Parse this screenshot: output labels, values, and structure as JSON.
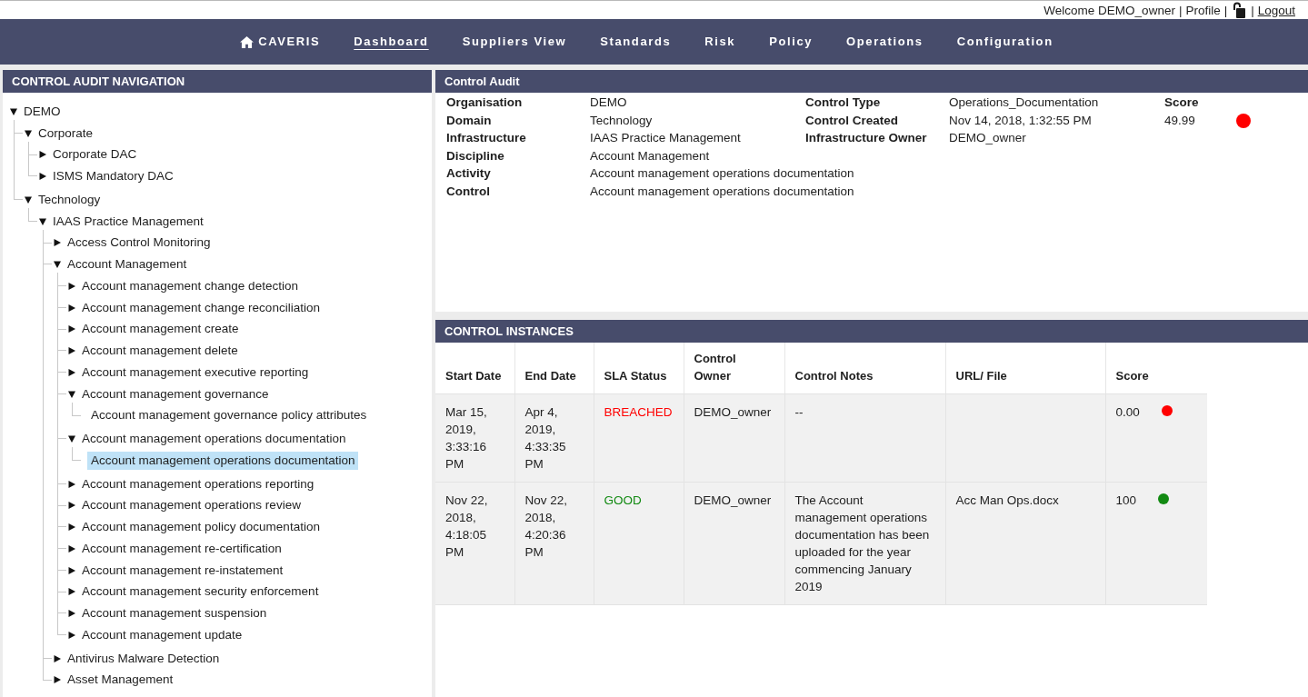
{
  "top_bar": {
    "items": [
      {
        "kind": "text",
        "text": "Welcome DEMO_owner"
      },
      {
        "kind": "separator",
        "text": "|"
      },
      {
        "kind": "link",
        "text": "Profile"
      },
      {
        "kind": "separator",
        "text": "|"
      },
      {
        "kind": "icon"
      },
      {
        "kind": "separator",
        "text": "|"
      },
      {
        "kind": "underlined_link",
        "text": "Logout"
      }
    ]
  },
  "navbar": {
    "brand": "CAVERIS",
    "items": [
      {
        "label": "Dashboard",
        "selected": true
      },
      {
        "label": "Suppliers View",
        "selected": false
      },
      {
        "label": "Standards",
        "selected": false
      },
      {
        "label": "Risk",
        "selected": false
      },
      {
        "label": "Policy",
        "selected": false
      },
      {
        "label": "Operations",
        "selected": false
      },
      {
        "label": "Configuration",
        "selected": false
      }
    ]
  },
  "navigation": {
    "title": "CONTROL AUDIT NAVIGATION",
    "tree": [
      {
        "label": "DEMO",
        "expanded": true,
        "selected": false,
        "children": [
          {
            "label": "Corporate",
            "expanded": true,
            "selected": false,
            "children": [
              {
                "label": "Corporate DAC",
                "expanded": false,
                "selected": false
              },
              {
                "label": "ISMS Mandatory DAC",
                "expanded": false,
                "selected": false
              }
            ]
          },
          {
            "label": "Technology",
            "expanded": true,
            "selected": false,
            "children": [
              {
                "label": "IAAS Practice Management",
                "expanded": true,
                "selected": false,
                "children": [
                  {
                    "label": "Access Control Monitoring",
                    "expanded": false,
                    "selected": false
                  },
                  {
                    "label": "Account Management",
                    "expanded": true,
                    "selected": false,
                    "children": [
                      {
                        "label": "Account management change detection",
                        "expanded": false,
                        "selected": false
                      },
                      {
                        "label": "Account management change reconciliation",
                        "expanded": false,
                        "selected": false
                      },
                      {
                        "label": "Account management create",
                        "expanded": false,
                        "selected": false
                      },
                      {
                        "label": "Account management delete",
                        "expanded": false,
                        "selected": false
                      },
                      {
                        "label": "Account management executive reporting",
                        "expanded": false,
                        "selected": false
                      },
                      {
                        "label": "Account management governance",
                        "expanded": true,
                        "selected": false,
                        "children": [
                          {
                            "label": "Account management governance policy attributes",
                            "selected": false
                          }
                        ]
                      },
                      {
                        "label": "Account management operations documentation",
                        "expanded": true,
                        "selected": false,
                        "children": [
                          {
                            "label": "Account management operations documentation",
                            "selected": true
                          }
                        ]
                      },
                      {
                        "label": "Account management operations reporting",
                        "expanded": false,
                        "selected": false
                      },
                      {
                        "label": "Account management operations review",
                        "expanded": false,
                        "selected": false
                      },
                      {
                        "label": "Account management policy documentation",
                        "expanded": false,
                        "selected": false
                      },
                      {
                        "label": "Account management re-certification",
                        "expanded": false,
                        "selected": false
                      },
                      {
                        "label": "Account management re-instatement",
                        "expanded": false,
                        "selected": false
                      },
                      {
                        "label": "Account management security enforcement",
                        "expanded": false,
                        "selected": false
                      },
                      {
                        "label": "Account management suspension",
                        "expanded": false,
                        "selected": false
                      },
                      {
                        "label": "Account management update",
                        "expanded": false,
                        "selected": false
                      }
                    ]
                  },
                  {
                    "label": "Antivirus Malware Detection",
                    "expanded": false,
                    "selected": false
                  },
                  {
                    "label": "Asset Management",
                    "expanded": false,
                    "selected": false
                  }
                ]
              }
            ]
          }
        ]
      }
    ]
  },
  "control_audit": {
    "title": "Control Audit",
    "fields": [
      {
        "label": "Organisation",
        "value": "DEMO"
      },
      {
        "label": "Domain",
        "value": "Technology"
      },
      {
        "label": "Infrastructure",
        "value": "IAAS Practice Management"
      },
      {
        "label": "Discipline",
        "value": "Account Management"
      },
      {
        "label": "Activity",
        "value": "Account management operations documentation"
      },
      {
        "label": "Control",
        "value": "Account management operations documentation"
      }
    ],
    "fields_2": [
      {
        "label": "Control Type",
        "value": "Operations_Documentation"
      },
      {
        "label": "Control Created",
        "value": "Nov 14, 2018, 1:32:55 PM"
      },
      {
        "label": "Infrastructure Owner",
        "value": "DEMO_owner"
      }
    ],
    "score": {
      "label": "Score",
      "value": "49.99",
      "color": "#ff0000"
    }
  },
  "control_instances": {
    "title": "CONTROL INSTANCES",
    "columns": [
      "Start Date",
      "End Date",
      "SLA Status",
      "Control Owner",
      "Control Notes",
      "URL/ File",
      "Score"
    ],
    "rows": [
      {
        "start_date": "Mar 15, 2019, 3:33:16 PM",
        "end_date": "Apr 4, 2019, 4:33:35 PM",
        "sla_status": "BREACHED",
        "control_owner": "DEMO_owner",
        "control_notes": "--",
        "score": "0.00",
        "color": "#ff0000"
      },
      {
        "start_date": "Nov 22, 2018, 4:18:05 PM",
        "end_date": "Nov 22, 2018, 4:20:36 PM",
        "sla_status": "GOOD",
        "control_owner": "DEMO_owner",
        "control_notes": "The Account management operations documentation has been uploaded for the year commencing January 2019",
        "url_file": "Acc Man Ops.docx",
        "score": "100",
        "color": "#128a12"
      }
    ]
  }
}
